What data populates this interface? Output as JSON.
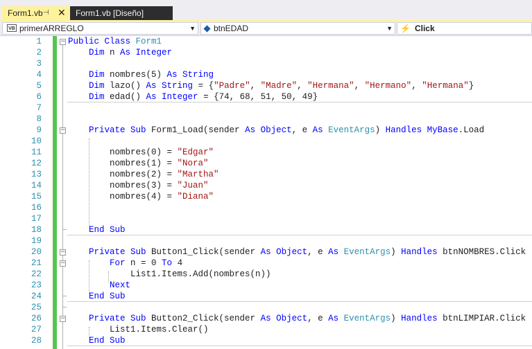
{
  "tabs": [
    {
      "label": "Form1.vb",
      "pin_icon": "pin-icon",
      "close_glyph": "✕"
    },
    {
      "label": "Form1.vb [Diseño]"
    }
  ],
  "nav": {
    "project_icon_text": "VB",
    "project": "primerARREGLO",
    "object": "btnEDAD",
    "member": "Click"
  },
  "colors": {
    "keyword": "#0000ff",
    "type": "#2b91af",
    "string": "#a31515",
    "text": "#1e1e1e",
    "line_number": "#2b91af",
    "change_bar": "#57c550",
    "active_tab": "#fff29d"
  },
  "code_lines": [
    {
      "n": "1",
      "fold": "minus",
      "tokens": [
        [
          "k",
          "Public Class "
        ],
        [
          "t",
          "Form1"
        ]
      ]
    },
    {
      "n": "2",
      "tokens": [
        [
          "p",
          "    "
        ],
        [
          "k",
          "Dim"
        ],
        [
          "p",
          " n "
        ],
        [
          "k",
          "As Integer"
        ]
      ]
    },
    {
      "n": "3",
      "tokens": []
    },
    {
      "n": "4",
      "tokens": [
        [
          "p",
          "    "
        ],
        [
          "k",
          "Dim"
        ],
        [
          "p",
          " nombres(5) "
        ],
        [
          "k",
          "As String"
        ]
      ]
    },
    {
      "n": "5",
      "tokens": [
        [
          "p",
          "    "
        ],
        [
          "k",
          "Dim"
        ],
        [
          "p",
          " lazo() "
        ],
        [
          "k",
          "As String"
        ],
        [
          "p",
          " = {"
        ],
        [
          "s",
          "\"Padre\""
        ],
        [
          "p",
          ", "
        ],
        [
          "s",
          "\"Madre\""
        ],
        [
          "p",
          ", "
        ],
        [
          "s",
          "\"Hermana\""
        ],
        [
          "p",
          ", "
        ],
        [
          "s",
          "\"Hermano\""
        ],
        [
          "p",
          ", "
        ],
        [
          "s",
          "\"Hermana\""
        ],
        [
          "p",
          "}"
        ]
      ]
    },
    {
      "n": "6",
      "sep": true,
      "tokens": [
        [
          "p",
          "    "
        ],
        [
          "k",
          "Dim"
        ],
        [
          "p",
          " edad() "
        ],
        [
          "k",
          "As Integer"
        ],
        [
          "p",
          " = {74, 68, 51, 50, 49}"
        ]
      ]
    },
    {
      "n": "7",
      "tokens": []
    },
    {
      "n": "8",
      "tokens": []
    },
    {
      "n": "9",
      "fold": "minus",
      "tokens": [
        [
          "p",
          "    "
        ],
        [
          "k",
          "Private Sub"
        ],
        [
          "p",
          " Form1_Load(sender "
        ],
        [
          "k",
          "As Object"
        ],
        [
          "p",
          ", e "
        ],
        [
          "k",
          "As "
        ],
        [
          "t",
          "EventArgs"
        ],
        [
          "p",
          ") "
        ],
        [
          "k",
          "Handles MyBase"
        ],
        [
          "p",
          ".Load"
        ]
      ]
    },
    {
      "n": "10",
      "tokens": []
    },
    {
      "n": "11",
      "tokens": [
        [
          "p",
          "        nombres(0) = "
        ],
        [
          "s",
          "\"Edgar\""
        ]
      ]
    },
    {
      "n": "12",
      "tokens": [
        [
          "p",
          "        nombres(1) = "
        ],
        [
          "s",
          "\"Nora\""
        ]
      ]
    },
    {
      "n": "13",
      "tokens": [
        [
          "p",
          "        nombres(2) = "
        ],
        [
          "s",
          "\"Martha\""
        ]
      ]
    },
    {
      "n": "14",
      "tokens": [
        [
          "p",
          "        nombres(3) = "
        ],
        [
          "s",
          "\"Juan\""
        ]
      ]
    },
    {
      "n": "15",
      "tokens": [
        [
          "p",
          "        nombres(4) = "
        ],
        [
          "s",
          "\"Diana\""
        ]
      ]
    },
    {
      "n": "16",
      "tokens": []
    },
    {
      "n": "17",
      "tokens": []
    },
    {
      "n": "18",
      "sep": true,
      "tokens": [
        [
          "p",
          "    "
        ],
        [
          "k",
          "End Sub"
        ]
      ]
    },
    {
      "n": "19",
      "tokens": []
    },
    {
      "n": "20",
      "fold": "minus",
      "tokens": [
        [
          "p",
          "    "
        ],
        [
          "k",
          "Private Sub"
        ],
        [
          "p",
          " Button1_Click(sender "
        ],
        [
          "k",
          "As Object"
        ],
        [
          "p",
          ", e "
        ],
        [
          "k",
          "As "
        ],
        [
          "t",
          "EventArgs"
        ],
        [
          "p",
          ") "
        ],
        [
          "k",
          "Handles"
        ],
        [
          "p",
          " btnNOMBRES.Click"
        ]
      ]
    },
    {
      "n": "21",
      "fold": "minus",
      "tokens": [
        [
          "p",
          "        "
        ],
        [
          "k",
          "For"
        ],
        [
          "p",
          " n = 0 "
        ],
        [
          "k",
          "To"
        ],
        [
          "p",
          " 4"
        ]
      ]
    },
    {
      "n": "22",
      "tokens": [
        [
          "p",
          "            List1.Items.Add(nombres(n))"
        ]
      ]
    },
    {
      "n": "23",
      "tokens": [
        [
          "p",
          "        "
        ],
        [
          "k",
          "Next"
        ]
      ]
    },
    {
      "n": "24",
      "sep": true,
      "tokens": [
        [
          "p",
          "    "
        ],
        [
          "k",
          "End Sub"
        ]
      ]
    },
    {
      "n": "25",
      "tokens": []
    },
    {
      "n": "26",
      "fold": "minus",
      "tokens": [
        [
          "p",
          "    "
        ],
        [
          "k",
          "Private Sub"
        ],
        [
          "p",
          " Button2_Click(sender "
        ],
        [
          "k",
          "As Object"
        ],
        [
          "p",
          ", e "
        ],
        [
          "k",
          "As "
        ],
        [
          "t",
          "EventArgs"
        ],
        [
          "p",
          ") "
        ],
        [
          "k",
          "Handles"
        ],
        [
          "p",
          " btnLIMPIAR.Click"
        ]
      ]
    },
    {
      "n": "27",
      "tokens": [
        [
          "p",
          "        List1.Items.Clear()"
        ]
      ]
    },
    {
      "n": "28",
      "sep": true,
      "tokens": [
        [
          "p",
          "    "
        ],
        [
          "k",
          "End Sub"
        ]
      ]
    }
  ]
}
